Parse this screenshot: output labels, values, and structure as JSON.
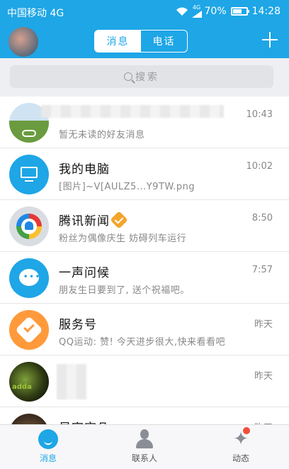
{
  "status_bar": {
    "carrier": "中国移动 4G",
    "network_small": "4G",
    "battery": "70%",
    "battery_level": 0.7,
    "time": "14:28"
  },
  "header": {
    "tabs": [
      {
        "label": "消息",
        "active": true
      },
      {
        "label": "电话",
        "active": false
      }
    ]
  },
  "search": {
    "placeholder": "搜索"
  },
  "conversations": [
    {
      "title": "",
      "subtitle": "暂无未读的好友消息",
      "time": "10:43"
    },
    {
      "title": "我的电脑",
      "subtitle": "[图片]~V[AULZ5...Y9TW.png",
      "time": "10:02"
    },
    {
      "title": "腾讯新闻",
      "subtitle": "粉丝为偶像庆生 妨碍列车运行",
      "time": "8:50"
    },
    {
      "title": "一声问候",
      "subtitle": "朋友生日要到了, 送个祝福吧。",
      "time": "7:57"
    },
    {
      "title": "服务号",
      "subtitle": "QQ运动: 赞! 今天进步很大,快来看看吧",
      "time": "昨天"
    },
    {
      "title": "",
      "subtitle": "",
      "time": "昨天"
    },
    {
      "title": "昊宇宗凡",
      "subtitle": "",
      "time": "昨天"
    }
  ],
  "avatar_texts": {
    "dark_avatar": "adda"
  },
  "tabbar": {
    "tabs": [
      {
        "label": "消息"
      },
      {
        "label": "联系人"
      },
      {
        "label": "动态"
      }
    ]
  },
  "colors": {
    "accent": "#1ea6e6",
    "service_orange": "#ff9a3c",
    "badge_red": "#f04e3a"
  }
}
